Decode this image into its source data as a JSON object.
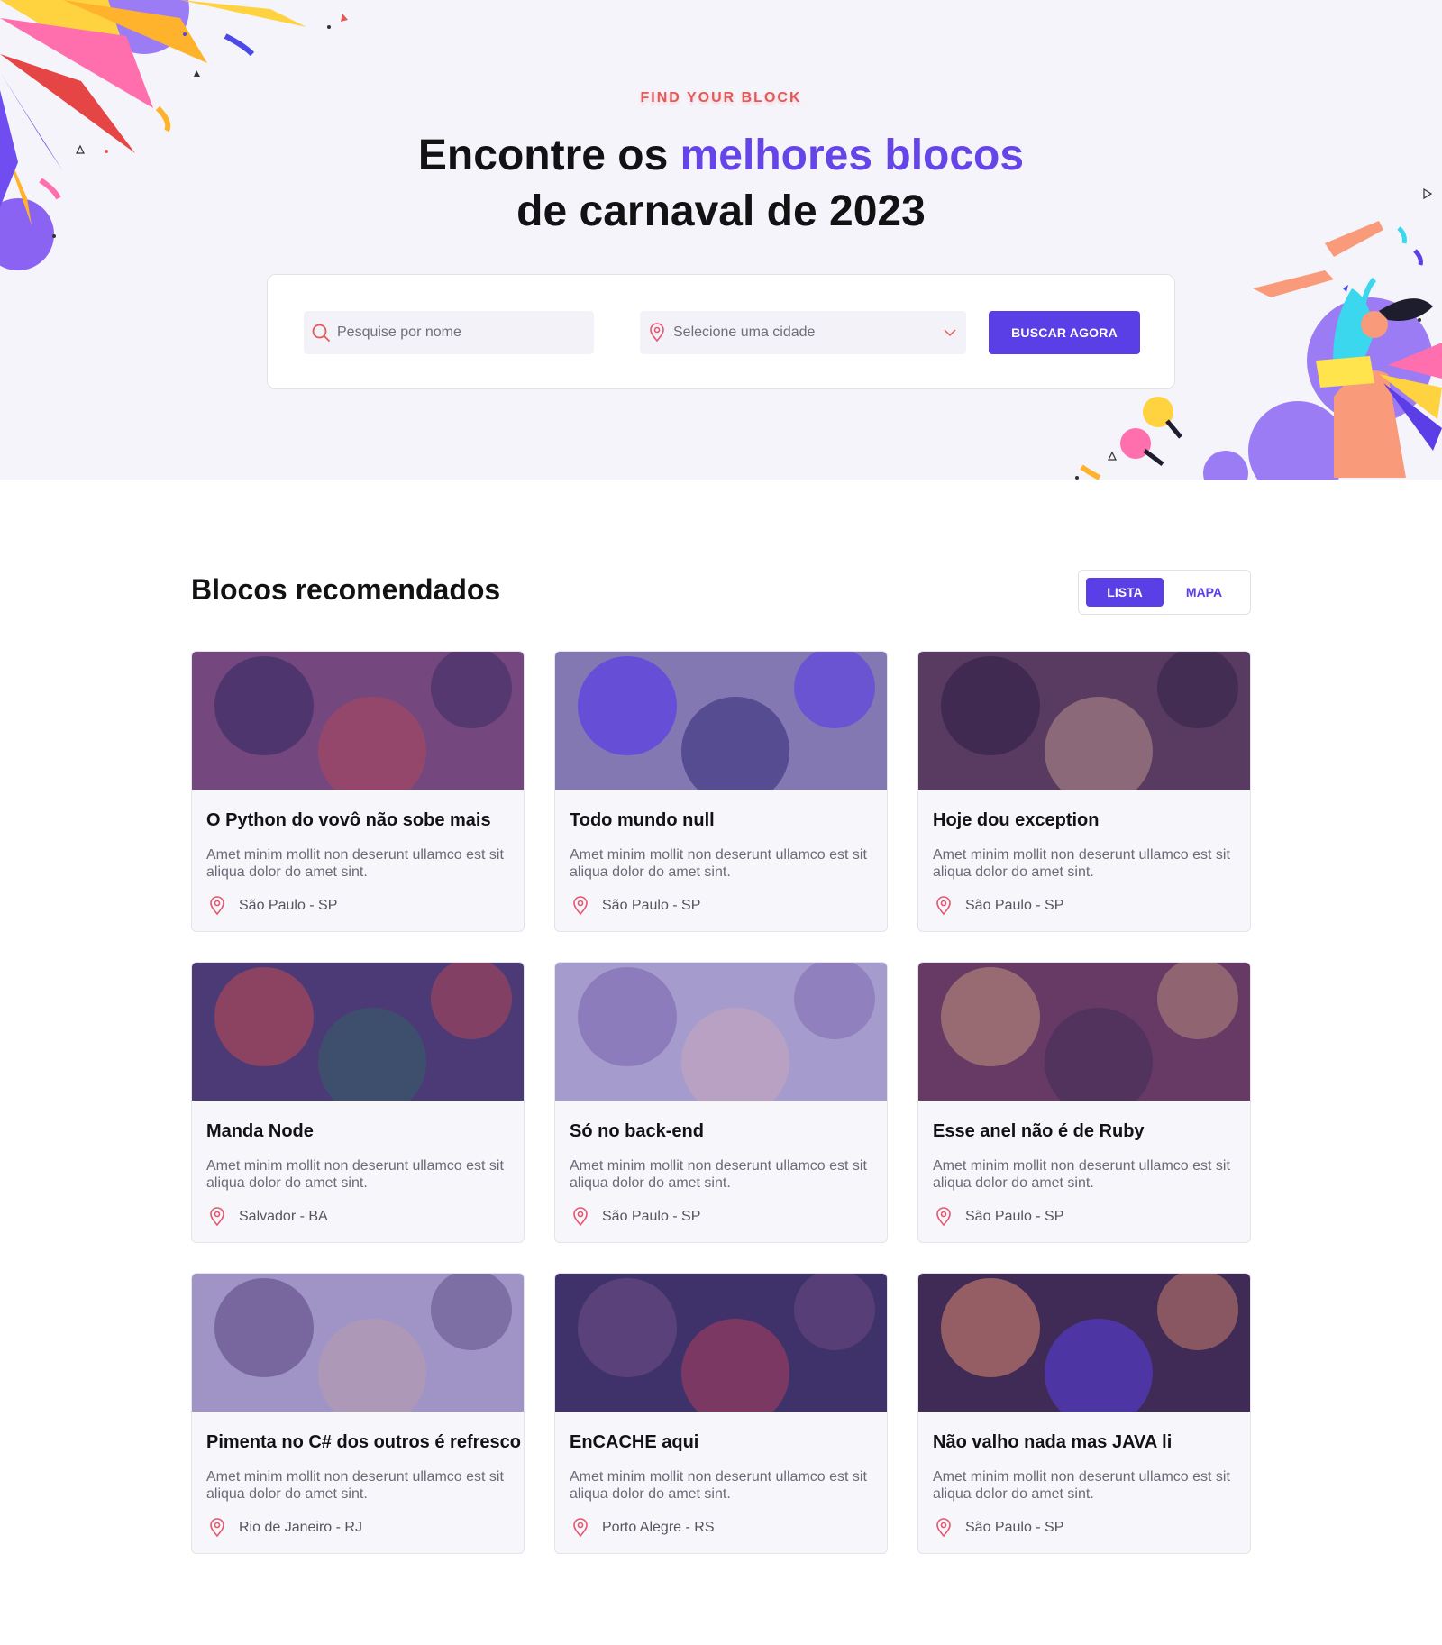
{
  "hero": {
    "eyebrow": "FIND YOUR BLOCK",
    "title_part1": "Encontre os ",
    "title_accent": "melhores blocos",
    "title_part2": "de carnaval de 2023"
  },
  "search": {
    "name_placeholder": "Pesquise por nome",
    "city_placeholder": "Selecione uma cidade",
    "button_label": "BUSCAR AGORA"
  },
  "section": {
    "title": "Blocos recomendados",
    "toggle_list": "LISTA",
    "toggle_map": "MAPA"
  },
  "colors": {
    "accent": "#5a3ee6",
    "accent_text": "#6645e8",
    "eyebrow": "#e45858",
    "pin": "#e4576f"
  },
  "icons": {
    "search": "search-icon",
    "city": "map-pin-icon",
    "dropdown": "chevron-down-icon"
  },
  "cards": [
    {
      "title": "O Python do vovô não sobe mais",
      "description": "Amet minim mollit non deserunt ullamco est sit aliqua dolor do amet sint.",
      "location": "São Paulo - SP"
    },
    {
      "title": "Todo mundo null",
      "description": "Amet minim mollit non deserunt ullamco est sit aliqua dolor do amet sint.",
      "location": "São Paulo - SP"
    },
    {
      "title": "Hoje dou exception",
      "description": "Amet minim mollit non deserunt ullamco est sit aliqua dolor do amet sint.",
      "location": "São Paulo - SP"
    },
    {
      "title": "Manda Node",
      "description": "Amet minim mollit non deserunt ullamco est sit aliqua dolor do amet sint.",
      "location": "Salvador - BA"
    },
    {
      "title": "Só no back-end",
      "description": "Amet minim mollit non deserunt ullamco est sit aliqua dolor do amet sint.",
      "location": "São Paulo - SP"
    },
    {
      "title": "Esse anel não é de Ruby",
      "description": "Amet minim mollit non deserunt ullamco est sit aliqua dolor do amet sint.",
      "location": "São Paulo - SP"
    },
    {
      "title": "Pimenta no C# dos outros é refresco",
      "description": "Amet minim mollit non deserunt ullamco est sit aliqua dolor do amet sint.",
      "location": "Rio de Janeiro - RJ"
    },
    {
      "title": "EnCACHE aqui",
      "description": "Amet minim mollit non deserunt ullamco est sit aliqua dolor do amet sint.",
      "location": "Porto Alegre - RS"
    },
    {
      "title": "Não valho nada mas JAVA li",
      "description": "Amet minim mollit non deserunt ullamco est sit aliqua dolor do amet sint.",
      "location": "São Paulo - SP"
    }
  ]
}
